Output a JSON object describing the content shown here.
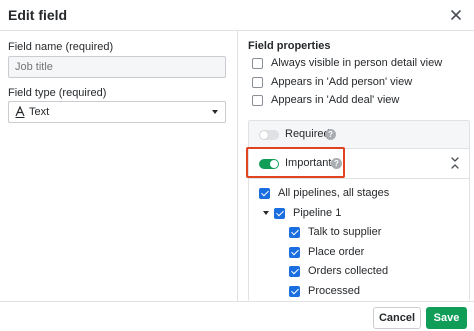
{
  "dialog": {
    "title": "Edit field"
  },
  "left": {
    "name_label": "Field name (required)",
    "name_placeholder": "Job title",
    "type_label": "Field type (required)",
    "type_icon": "text-type-icon",
    "type_value": "Text"
  },
  "properties": {
    "title": "Field properties",
    "options": [
      {
        "label": "Always visible in person detail view",
        "checked": false
      },
      {
        "label": "Appears in 'Add person' view",
        "checked": false
      },
      {
        "label": "Appears in 'Add deal' view",
        "checked": false
      }
    ],
    "required": {
      "label": "Required",
      "on": false
    },
    "important": {
      "label": "Important",
      "on": true
    },
    "all_pipelines": {
      "label": "All pipelines, all stages",
      "checked": true
    },
    "pipeline": {
      "label": "Pipeline 1",
      "checked": true,
      "expanded": true
    },
    "stages": [
      {
        "label": "Talk to supplier",
        "checked": true
      },
      {
        "label": "Place order",
        "checked": true
      },
      {
        "label": "Orders collected",
        "checked": true
      },
      {
        "label": "Processed",
        "checked": true
      }
    ]
  },
  "footer": {
    "cancel_label": "Cancel",
    "save_label": "Save"
  },
  "colors": {
    "accent_green": "#0f9d58",
    "checkbox_blue": "#1b6ee0",
    "highlight_red": "#e0431f"
  }
}
